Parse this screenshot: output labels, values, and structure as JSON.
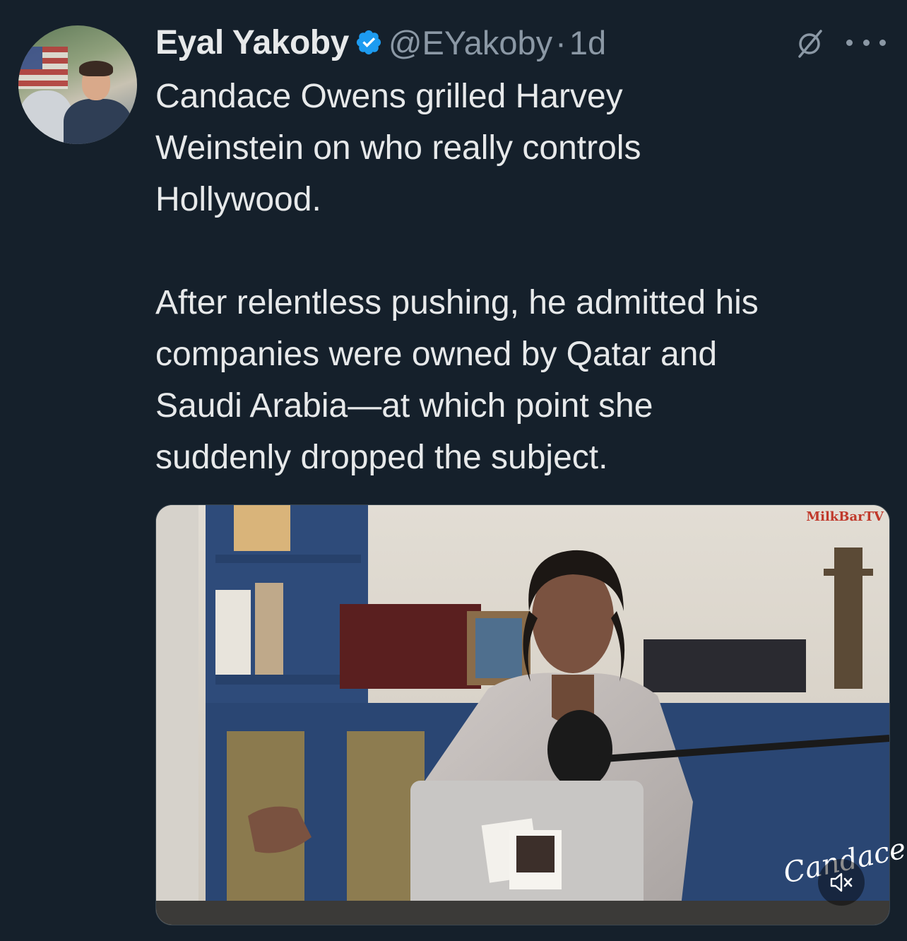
{
  "tweet": {
    "author_name": "Eyal Yakoby",
    "handle": "@EYakoby",
    "separator": "·",
    "time": "1d",
    "text": "Candace Owens grilled Harvey\nWeinstein on who really controls\nHollywood.\n\nAfter relentless pushing, he admitted his\ncompanies were owned by Qatar and\nSaudi Arabia—at which point she\nsuddenly dropped the subject."
  },
  "media": {
    "watermark": "MilkBarTV",
    "logo_text": "Candace",
    "mute_state": "muted"
  },
  "icons": {
    "verified": "verified-badge-icon",
    "grok": "grok-icon",
    "more": "more-icon",
    "mute": "volume-muted-icon"
  },
  "colors": {
    "background": "#15202b",
    "text": "#e7e9ea",
    "secondary": "#8b98a5",
    "verified": "#1d9bf0"
  }
}
